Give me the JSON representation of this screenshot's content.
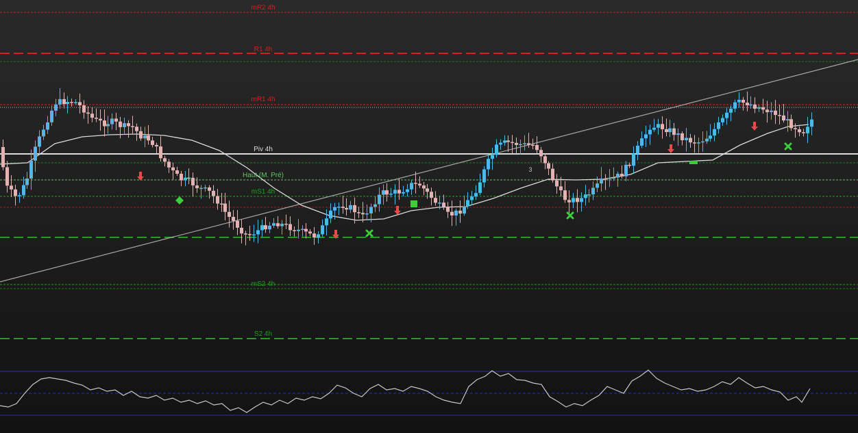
{
  "chart_data": {
    "type": "candlestick",
    "title": "",
    "xlabel": "",
    "ylabel": "",
    "ylim": [
      0,
      633
    ],
    "colors": {
      "background_top": "#262626",
      "background_bottom": "#141414",
      "bull_candle": "#4fb8e6",
      "bear_candle": "#e3b3b3",
      "resistance": "#d42020",
      "support": "#20a020",
      "pivot": "#dcdcdc",
      "moving_average": "#dcdcdc",
      "trendline": "#a8a8a8",
      "oscillator": "#c8c8c8",
      "oscillator_band": "#2a2ad0",
      "signal_down_arrow": "#e84b4b",
      "signal_marker": "#3ccc3c"
    },
    "levels": [
      {
        "name": "mR2 4h",
        "value": 18,
        "color": "#d42020",
        "style": "dotted-thin",
        "bind": "mR2"
      },
      {
        "name": "R1 4h",
        "value": 78,
        "color": "#d42020",
        "style": "dashed-thick",
        "bind": "R1"
      },
      {
        "name": "mR1 4h",
        "value": 153,
        "color": "#d42020",
        "style": "dotted-thin",
        "bind": "mR1"
      },
      {
        "name": "Piv 4h",
        "value": 225,
        "color": "#dcdcdc",
        "style": "solid",
        "bind": "Piv"
      },
      {
        "name": "Haut (M. Pré)",
        "value": 263,
        "color": "#5ec85e",
        "style": "dotted-thin",
        "bind": "Haut"
      },
      {
        "name": "mS1 4h",
        "value": 287,
        "color": "#20a020",
        "style": "dotted-thin",
        "bind": "mS1"
      },
      {
        "name": "mS2 4h",
        "value": 416,
        "color": "#20a020",
        "style": "dotted-thin",
        "bind": "mS2"
      },
      {
        "name": "S2 4h",
        "value": 495,
        "color": "#20a020",
        "style": "dashed-thick",
        "bind": "S2"
      }
    ],
    "level_labels": {
      "mR2": "mR2 4h",
      "R1": "R1 4h",
      "mR1": "mR1 4h",
      "Piv": "Piv 4h",
      "Haut": "Haut (M. Pré)",
      "mS1": "mS1 4h",
      "mS2": "mS2 4h",
      "S2": "S2 4h"
    },
    "candle_path": [
      [
        0,
        205
      ],
      [
        14,
        275
      ],
      [
        28,
        290
      ],
      [
        42,
        265
      ],
      [
        56,
        215
      ],
      [
        70,
        180
      ],
      [
        84,
        150
      ],
      [
        98,
        148
      ],
      [
        112,
        148
      ],
      [
        126,
        160
      ],
      [
        140,
        175
      ],
      [
        154,
        180
      ],
      [
        168,
        178
      ],
      [
        182,
        185
      ],
      [
        196,
        185
      ],
      [
        210,
        200
      ],
      [
        224,
        205
      ],
      [
        238,
        228
      ],
      [
        252,
        248
      ],
      [
        266,
        262
      ],
      [
        280,
        265
      ],
      [
        294,
        275
      ],
      [
        308,
        280
      ],
      [
        322,
        295
      ],
      [
        336,
        315
      ],
      [
        350,
        330
      ],
      [
        364,
        345
      ],
      [
        378,
        338
      ],
      [
        392,
        330
      ],
      [
        406,
        325
      ],
      [
        420,
        330
      ],
      [
        434,
        335
      ],
      [
        448,
        340
      ],
      [
        462,
        345
      ],
      [
        476,
        330
      ],
      [
        490,
        305
      ],
      [
        504,
        300
      ],
      [
        518,
        305
      ],
      [
        532,
        318
      ],
      [
        546,
        300
      ],
      [
        560,
        282
      ],
      [
        574,
        282
      ],
      [
        588,
        280
      ],
      [
        602,
        270
      ],
      [
        616,
        270
      ],
      [
        630,
        285
      ],
      [
        644,
        300
      ],
      [
        658,
        315
      ],
      [
        672,
        310
      ],
      [
        686,
        295
      ],
      [
        700,
        275
      ],
      [
        714,
        240
      ],
      [
        728,
        215
      ],
      [
        742,
        208
      ],
      [
        756,
        210
      ],
      [
        770,
        212
      ],
      [
        784,
        212
      ],
      [
        798,
        235
      ],
      [
        812,
        265
      ],
      [
        826,
        290
      ],
      [
        840,
        292
      ],
      [
        854,
        290
      ],
      [
        868,
        280
      ],
      [
        882,
        265
      ],
      [
        896,
        262
      ],
      [
        910,
        255
      ],
      [
        924,
        235
      ],
      [
        938,
        210
      ],
      [
        952,
        185
      ],
      [
        966,
        185
      ],
      [
        980,
        190
      ],
      [
        994,
        198
      ],
      [
        1008,
        205
      ],
      [
        1022,
        208
      ],
      [
        1036,
        200
      ],
      [
        1050,
        185
      ],
      [
        1064,
        168
      ],
      [
        1078,
        150
      ],
      [
        1092,
        150
      ],
      [
        1106,
        155
      ],
      [
        1120,
        160
      ],
      [
        1134,
        165
      ],
      [
        1148,
        175
      ],
      [
        1162,
        185
      ],
      [
        1176,
        192
      ],
      [
        1186,
        175
      ]
    ],
    "moving_average": [
      [
        0,
        240
      ],
      [
        40,
        238
      ],
      [
        80,
        210
      ],
      [
        120,
        200
      ],
      [
        160,
        197
      ],
      [
        200,
        196
      ],
      [
        240,
        198
      ],
      [
        280,
        205
      ],
      [
        320,
        220
      ],
      [
        360,
        245
      ],
      [
        400,
        275
      ],
      [
        440,
        300
      ],
      [
        480,
        315
      ],
      [
        520,
        322
      ],
      [
        560,
        320
      ],
      [
        600,
        308
      ],
      [
        640,
        303
      ],
      [
        680,
        302
      ],
      [
        720,
        290
      ],
      [
        760,
        275
      ],
      [
        800,
        262
      ],
      [
        840,
        263
      ],
      [
        880,
        262
      ],
      [
        920,
        255
      ],
      [
        960,
        238
      ],
      [
        1000,
        236
      ],
      [
        1040,
        234
      ],
      [
        1080,
        212
      ],
      [
        1120,
        195
      ],
      [
        1150,
        185
      ],
      [
        1180,
        182
      ]
    ],
    "trendline": [
      [
        0,
        412
      ],
      [
        1252,
        87
      ]
    ],
    "oscillator": {
      "upper_band": 543,
      "mid_band": 575,
      "lower_band": 607,
      "values": [
        [
          0,
          593
        ],
        [
          12,
          595
        ],
        [
          24,
          590
        ],
        [
          36,
          575
        ],
        [
          48,
          562
        ],
        [
          60,
          554
        ],
        [
          72,
          552
        ],
        [
          84,
          554
        ],
        [
          96,
          556
        ],
        [
          108,
          560
        ],
        [
          120,
          563
        ],
        [
          132,
          570
        ],
        [
          144,
          567
        ],
        [
          156,
          572
        ],
        [
          168,
          570
        ],
        [
          180,
          578
        ],
        [
          192,
          572
        ],
        [
          204,
          580
        ],
        [
          216,
          582
        ],
        [
          228,
          578
        ],
        [
          240,
          585
        ],
        [
          252,
          582
        ],
        [
          264,
          588
        ],
        [
          276,
          585
        ],
        [
          288,
          590
        ],
        [
          300,
          586
        ],
        [
          312,
          592
        ],
        [
          324,
          590
        ],
        [
          336,
          600
        ],
        [
          348,
          596
        ],
        [
          360,
          603
        ],
        [
          372,
          595
        ],
        [
          384,
          588
        ],
        [
          396,
          592
        ],
        [
          408,
          585
        ],
        [
          420,
          590
        ],
        [
          432,
          582
        ],
        [
          444,
          585
        ],
        [
          456,
          580
        ],
        [
          468,
          583
        ],
        [
          480,
          575
        ],
        [
          492,
          563
        ],
        [
          504,
          567
        ],
        [
          516,
          575
        ],
        [
          528,
          580
        ],
        [
          540,
          568
        ],
        [
          552,
          562
        ],
        [
          564,
          570
        ],
        [
          576,
          568
        ],
        [
          588,
          572
        ],
        [
          600,
          565
        ],
        [
          612,
          568
        ],
        [
          624,
          572
        ],
        [
          636,
          580
        ],
        [
          648,
          585
        ],
        [
          660,
          588
        ],
        [
          672,
          590
        ],
        [
          684,
          565
        ],
        [
          696,
          555
        ],
        [
          708,
          550
        ],
        [
          718,
          542
        ],
        [
          730,
          550
        ],
        [
          742,
          546
        ],
        [
          754,
          555
        ],
        [
          766,
          556
        ],
        [
          778,
          560
        ],
        [
          790,
          562
        ],
        [
          802,
          580
        ],
        [
          814,
          587
        ],
        [
          826,
          595
        ],
        [
          838,
          590
        ],
        [
          850,
          593
        ],
        [
          862,
          585
        ],
        [
          874,
          578
        ],
        [
          886,
          565
        ],
        [
          898,
          570
        ],
        [
          910,
          575
        ],
        [
          922,
          557
        ],
        [
          934,
          550
        ],
        [
          946,
          541
        ],
        [
          958,
          553
        ],
        [
          970,
          560
        ],
        [
          982,
          565
        ],
        [
          994,
          570
        ],
        [
          1006,
          568
        ],
        [
          1018,
          572
        ],
        [
          1030,
          570
        ],
        [
          1042,
          565
        ],
        [
          1054,
          558
        ],
        [
          1066,
          562
        ],
        [
          1078,
          552
        ],
        [
          1090,
          560
        ],
        [
          1102,
          567
        ],
        [
          1114,
          565
        ],
        [
          1126,
          570
        ],
        [
          1138,
          573
        ],
        [
          1150,
          585
        ],
        [
          1162,
          580
        ],
        [
          1170,
          588
        ],
        [
          1182,
          568
        ]
      ]
    },
    "signals": [
      {
        "type": "down-arrow",
        "x": 205,
        "y": 258
      },
      {
        "type": "down-arrow",
        "x": 490,
        "y": 343
      },
      {
        "type": "down-arrow",
        "x": 580,
        "y": 308
      },
      {
        "type": "down-arrow",
        "x": 979,
        "y": 218
      },
      {
        "type": "down-arrow",
        "x": 1101,
        "y": 185
      },
      {
        "type": "diamond",
        "x": 262,
        "y": 293
      },
      {
        "type": "square",
        "x": 604,
        "y": 298
      },
      {
        "type": "dash",
        "x": 1012,
        "y": 237
      },
      {
        "type": "x-mark",
        "x": 539,
        "y": 341
      },
      {
        "type": "x-mark",
        "x": 832,
        "y": 315
      },
      {
        "type": "x-mark",
        "x": 1150,
        "y": 214
      }
    ],
    "annotations": [
      {
        "text": "3",
        "x": 774,
        "y": 251
      }
    ]
  }
}
